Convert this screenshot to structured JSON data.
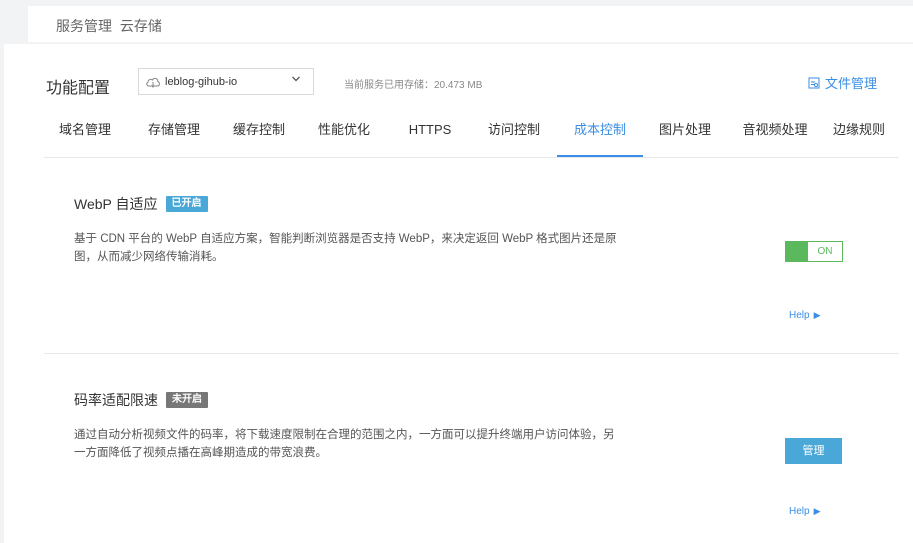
{
  "breadcrumb": {
    "items": [
      "服务管理",
      "云存储"
    ]
  },
  "header": {
    "config_title": "功能配置",
    "bucket": {
      "selected": "leblog-gihub-io"
    },
    "storage_info": "当前服务已用存储：20.473 MB",
    "file_manage_label": "文件管理"
  },
  "tabs": [
    {
      "label": "域名管理"
    },
    {
      "label": "存储管理"
    },
    {
      "label": "缓存控制"
    },
    {
      "label": "性能优化"
    },
    {
      "label": "HTTPS"
    },
    {
      "label": "访问控制"
    },
    {
      "label": "成本控制",
      "active": true
    },
    {
      "label": "图片处理"
    },
    {
      "label": "音视频处理"
    },
    {
      "label": "边缘规则"
    }
  ],
  "sections": [
    {
      "title": "WebP 自适应",
      "badge": "已开启",
      "description": "基于 CDN 平台的 WebP 自适应方案，智能判断浏览器是否支持 WebP，来决定返回 WebP 格式图片还是原图，从而减少网络传输消耗。",
      "toggle_label": "ON",
      "help_label": "Help"
    },
    {
      "title": "码率适配限速",
      "badge": "未开启",
      "description": "通过自动分析视频文件的码率，将下载速度限制在合理的范围之内，一方面可以提升终端用户访问体验，另一方面降低了视频点播在高峰期造成的带宽浪费。",
      "button_label": "管理",
      "help_label": "Help"
    }
  ],
  "colors": {
    "accent": "#3a8ee6",
    "badge_on": "#4aa8d8",
    "badge_off": "#777777",
    "toggle_on": "#5cb85c"
  }
}
